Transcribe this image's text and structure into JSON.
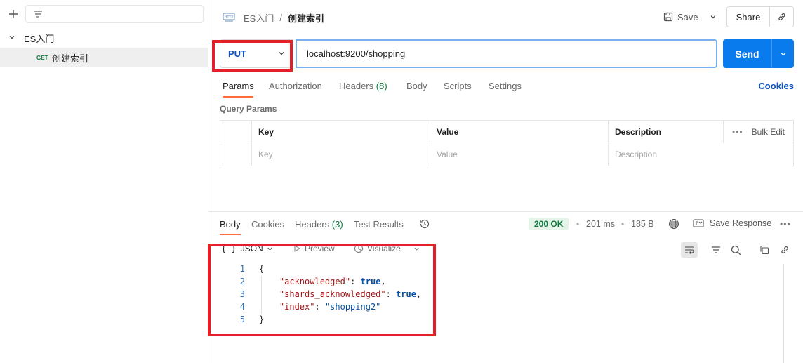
{
  "sidebar": {
    "collection_name": "ES入门",
    "request": {
      "method": "GET",
      "name": "创建索引"
    }
  },
  "header": {
    "breadcrumb_parent": "ES入门",
    "breadcrumb_sep": "/",
    "breadcrumb_current": "创建索引",
    "save_label": "Save",
    "share_label": "Share"
  },
  "request": {
    "method": "PUT",
    "url": "localhost:9200/shopping",
    "send_label": "Send"
  },
  "req_tabs": {
    "params": "Params",
    "authorization": "Authorization",
    "headers_label": "Headers",
    "headers_count": "(8)",
    "body": "Body",
    "scripts": "Scripts",
    "settings": "Settings",
    "cookies": "Cookies"
  },
  "query_params": {
    "title": "Query Params",
    "columns": [
      "Key",
      "Value",
      "Description"
    ],
    "bulk_edit": "Bulk Edit",
    "placeholders": [
      "Key",
      "Value",
      "Description"
    ]
  },
  "response": {
    "tabs": {
      "body": "Body",
      "cookies": "Cookies",
      "headers_label": "Headers",
      "headers_count": "(3)",
      "test_results": "Test Results"
    },
    "status": "200 OK",
    "time": "201 ms",
    "size": "185 B",
    "save_response": "Save Response",
    "format": "JSON",
    "preview": "Preview",
    "visualize": "Visualize",
    "line_numbers": [
      "1",
      "2",
      "3",
      "4",
      "5"
    ],
    "body": {
      "open": "{",
      "k1": "\"acknowledged\"",
      "v1": "true",
      "k2": "\"shards_acknowledged\"",
      "v2": "true",
      "k3": "\"index\"",
      "v3": "\"shopping2\"",
      "close": "}"
    }
  },
  "colors": {
    "accent": "#097bed",
    "method_put": "#0a52c5",
    "method_get": "#0c7a3e",
    "status_ok": "#0c7a3e",
    "tab_indicator": "#ff6c37",
    "highlight_box": "#e41e2b"
  }
}
